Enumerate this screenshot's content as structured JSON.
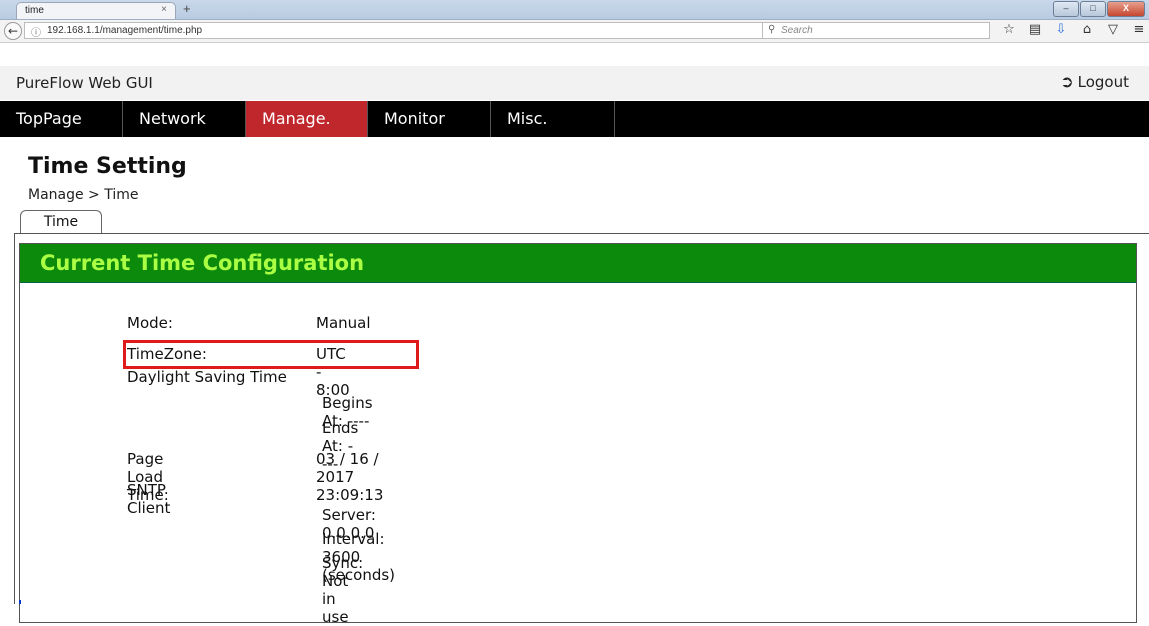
{
  "browser": {
    "tab_title": "time",
    "tab_close": "×",
    "new_tab": "+",
    "window_buttons": [
      "–",
      "□",
      "X"
    ],
    "url": "192.168.1.1/management/time.php",
    "url_actions": "▿  C",
    "search_placeholder": "Search"
  },
  "app": {
    "title": "PureFlow Web GUI",
    "logout_label": "Logout"
  },
  "menu": {
    "items": [
      "TopPage",
      "Network",
      "Manage.",
      "Monitor",
      "Misc."
    ],
    "active": "Manage."
  },
  "page": {
    "title": "Time Setting",
    "breadcrumb": "Manage > Time",
    "subtab": "Time"
  },
  "panel": {
    "title": "Current Time Configuration",
    "mode_label": "Mode:",
    "mode_value": "Manual",
    "timezone_label": "TimeZone:",
    "timezone_value": "UTC - 8:00",
    "dst_label": "Daylight Saving Time",
    "dst_begins": "Begins At: ----",
    "dst_ends": "Ends At: ----",
    "pageload_label": "Page Load Time:",
    "pageload_value": "03 / 16 / 2017 23:09:13",
    "sntp_label": "SNTP Client",
    "sntp_server": "Server: 0.0.0.0",
    "sntp_interval": "Interval: 3600 (seconds)",
    "sntp_sync": "Sync: Not in use"
  },
  "colors": {
    "menu_bg": "#000000",
    "menu_active": "#c0272d",
    "panel_header": "#0b8a0b",
    "panel_title": "#aaff44",
    "highlight": "#e01a1a"
  }
}
